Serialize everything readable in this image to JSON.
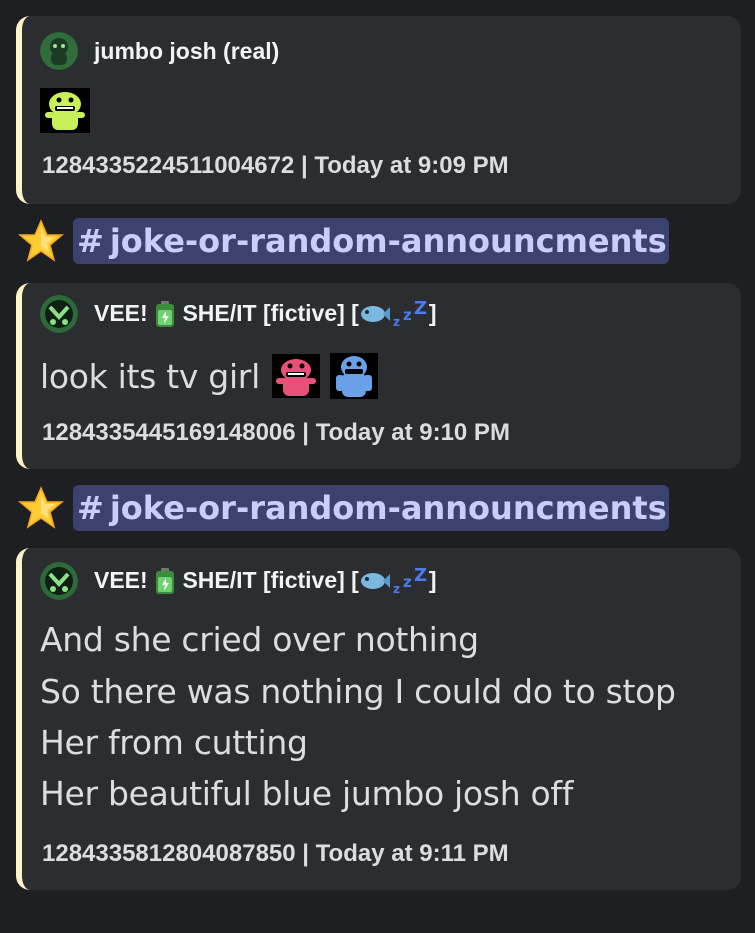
{
  "messages": [
    {
      "author": "jumbo josh (real)",
      "footer": "1284335224511004672 | Today at 9:09 PM"
    },
    {
      "channel": "joke-or-random-announcments",
      "author_prefix": "VEE!",
      "author_middle": "SHE/IT [fictive] [",
      "author_suffix": "]",
      "body": "look its tv girl",
      "footer": "1284335445169148006 | Today at 9:10 PM"
    },
    {
      "channel": "joke-or-random-announcments",
      "author_prefix": "VEE!",
      "author_middle": "SHE/IT [fictive] [",
      "author_suffix": "]",
      "body_lines": [
        "And she cried over nothing",
        "So there was nothing I could do to stop",
        "Her from cutting",
        "Her beautiful blue jumbo josh off"
      ],
      "footer": "1284335812804087850 | Today at 9:11 PM"
    }
  ],
  "hash_symbol": "#",
  "zzz": "z",
  "icons": [
    "avatar-jumbo-josh",
    "green-jumbo-josh-emoji",
    "star-icon",
    "battery-emoji",
    "fish-emoji",
    "sleeping-zzz-emoji",
    "pink-jumbo-josh-emoji",
    "blue-jumbo-josh-emoji"
  ],
  "colors": {
    "background": "#1e1f23",
    "embed_bg": "#2b2d31",
    "embed_border": "#fdf3c9",
    "channel_pill": "#3c4270",
    "channel_text": "#c9cdfb"
  }
}
